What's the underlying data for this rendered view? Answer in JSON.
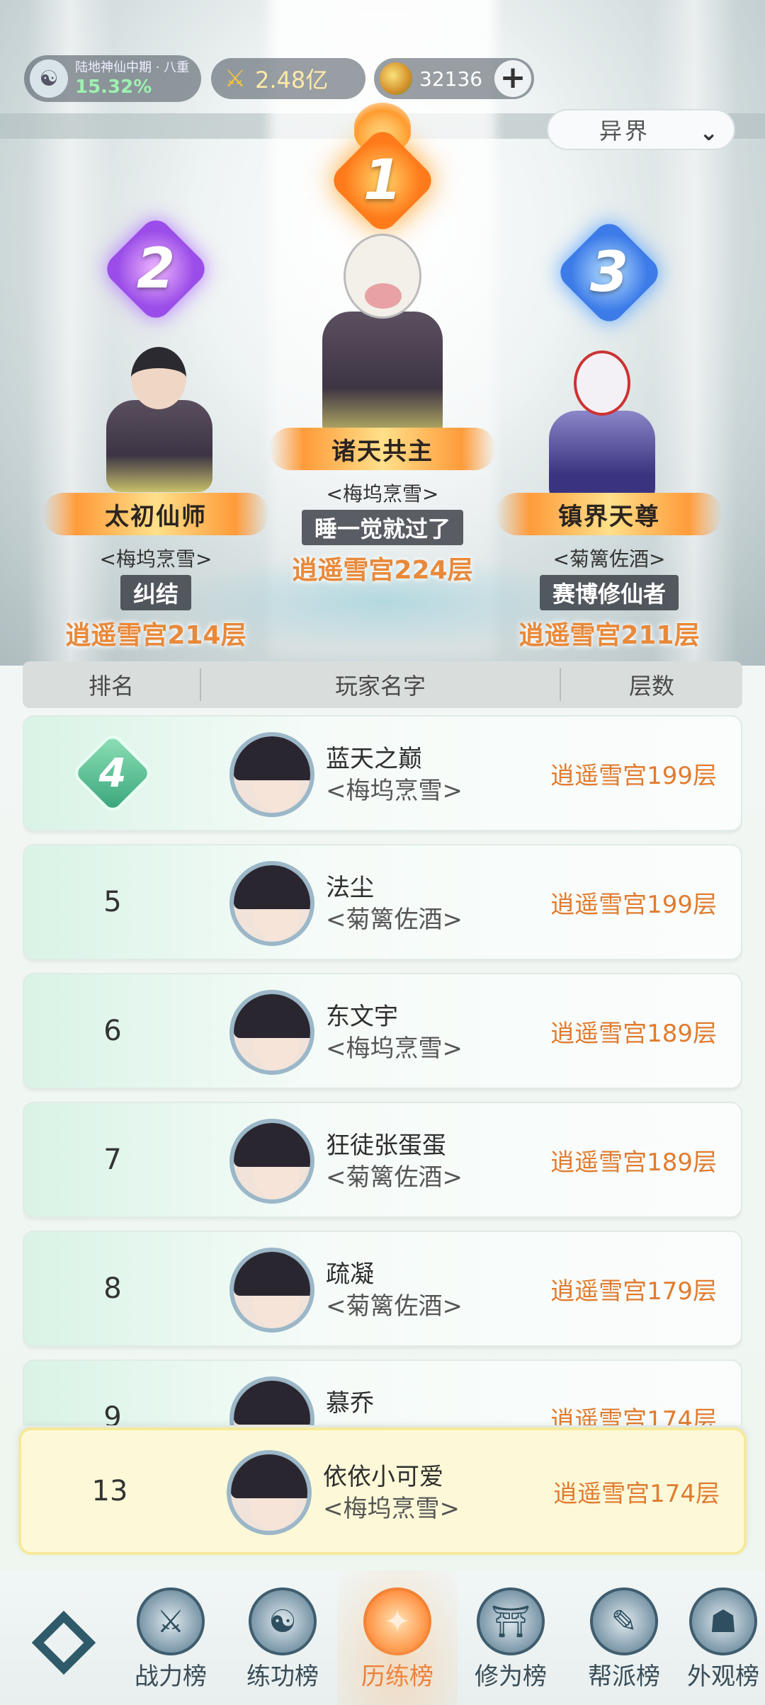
{
  "status": {
    "realm_name": "陆地神仙中期 · 八重",
    "realm_percent": "15.32%",
    "power": "2.48亿",
    "coins": "32136",
    "coin_add": "+"
  },
  "realm_select": {
    "label": "异界",
    "chevron": "⌄"
  },
  "podium": [
    {
      "rank": "1",
      "title": "诸天共主",
      "guild": "<梅坞烹雪>",
      "player": "睡一觉就过了",
      "floor": "逍遥雪宫224层"
    },
    {
      "rank": "2",
      "title": "太初仙师",
      "guild": "<梅坞烹雪>",
      "player": "纠结",
      "floor": "逍遥雪宫214层"
    },
    {
      "rank": "3",
      "title": "镇界天尊",
      "guild": "<菊篱佐酒>",
      "player": "赛博修仙者",
      "floor": "逍遥雪宫211层"
    }
  ],
  "table_header": {
    "rank": "排名",
    "name": "玩家名字",
    "floor": "层数"
  },
  "rows": [
    {
      "rank": "4",
      "player": "蓝天之巅",
      "guild": "<梅坞烹雪>",
      "floor": "逍遥雪宫199层"
    },
    {
      "rank": "5",
      "player": "法尘",
      "guild": "<菊篱佐酒>",
      "floor": "逍遥雪宫199层"
    },
    {
      "rank": "6",
      "player": "东文宇",
      "guild": "<梅坞烹雪>",
      "floor": "逍遥雪宫189层"
    },
    {
      "rank": "7",
      "player": "狂徒张蛋蛋",
      "guild": "<菊篱佐酒>",
      "floor": "逍遥雪宫189层"
    },
    {
      "rank": "8",
      "player": "疏凝",
      "guild": "<菊篱佐酒>",
      "floor": "逍遥雪宫179层"
    },
    {
      "rank": "9",
      "player": "慕乔",
      "guild": "",
      "floor": "逍遥雪宫174层"
    }
  ],
  "self_row": {
    "rank": "13",
    "player": "依依小可爱",
    "guild": "<梅坞烹雪>",
    "floor": "逍遥雪宫174层"
  },
  "nav": [
    {
      "label": "战力榜",
      "icon": "sword-icon"
    },
    {
      "label": "练功榜",
      "icon": "yinyang-icon"
    },
    {
      "label": "历练榜",
      "icon": "star-icon"
    },
    {
      "label": "修为榜",
      "icon": "hat-icon"
    },
    {
      "label": "帮派榜",
      "icon": "scroll-icon"
    },
    {
      "label": "外观榜",
      "icon": "mask-icon"
    }
  ],
  "colors": {
    "accent": "#e8893a",
    "active_tab": "#e8702a",
    "rank4_gem": "#38a57a"
  }
}
